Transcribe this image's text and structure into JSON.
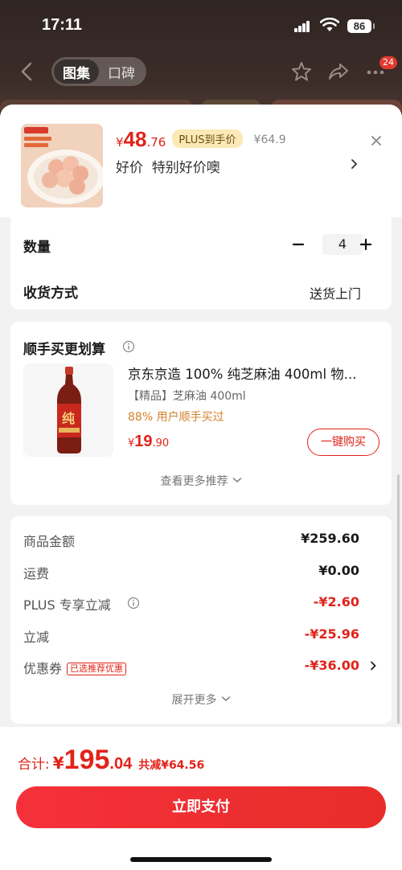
{
  "status_bar": {
    "time": "17:11",
    "battery": "86"
  },
  "nav": {
    "tabs": [
      {
        "label": "图集",
        "active": true
      },
      {
        "label": "口碑",
        "active": false
      }
    ],
    "message_badge": "24",
    "icons": [
      "back-icon",
      "star-icon",
      "share-icon",
      "more-icon"
    ]
  },
  "product": {
    "currency": "¥",
    "price_int": "48",
    "price_dec": ".76",
    "plus_tag": "PLUS到手价",
    "original_price": "¥64.9",
    "subtitle": "好价  特别好价噢"
  },
  "order": {
    "quantity_label": "数量",
    "quantity": "4",
    "shipping_label": "收货方式",
    "shipping_value": "送货上门"
  },
  "recommend": {
    "title": "顺手买更划算",
    "item_title": "京东京造 100% 纯芝麻油 400ml 物...",
    "item_spec": "【精品】芝麻油 400ml",
    "item_hint": "88% 用户顺手买过",
    "price_sym": "¥",
    "price_int": "19",
    "price_dec": ".90",
    "buy_button": "一键购买",
    "more_label": "查看更多推荐"
  },
  "summary": {
    "rows": [
      {
        "label": "商品金额",
        "value": "¥259.60"
      },
      {
        "label": "运费",
        "value": "¥0.00"
      },
      {
        "label": "PLUS 专享立减",
        "value": "-¥2.60"
      },
      {
        "label": "立减",
        "value": "-¥25.96"
      },
      {
        "label": "优惠券",
        "value": "-¥36.00",
        "tag": "已选推荐优惠"
      }
    ],
    "expand_label": "展开更多"
  },
  "footer": {
    "total_label": "合计:",
    "total_sym": "¥",
    "total_int": "195",
    "total_dec": ".04",
    "saving": "共减¥64.56",
    "pay_button": "立即支付"
  },
  "colors": {
    "accent": "#e2231a",
    "plus_tag_bg": "#fbe9b6",
    "hint": "#d4812a"
  }
}
